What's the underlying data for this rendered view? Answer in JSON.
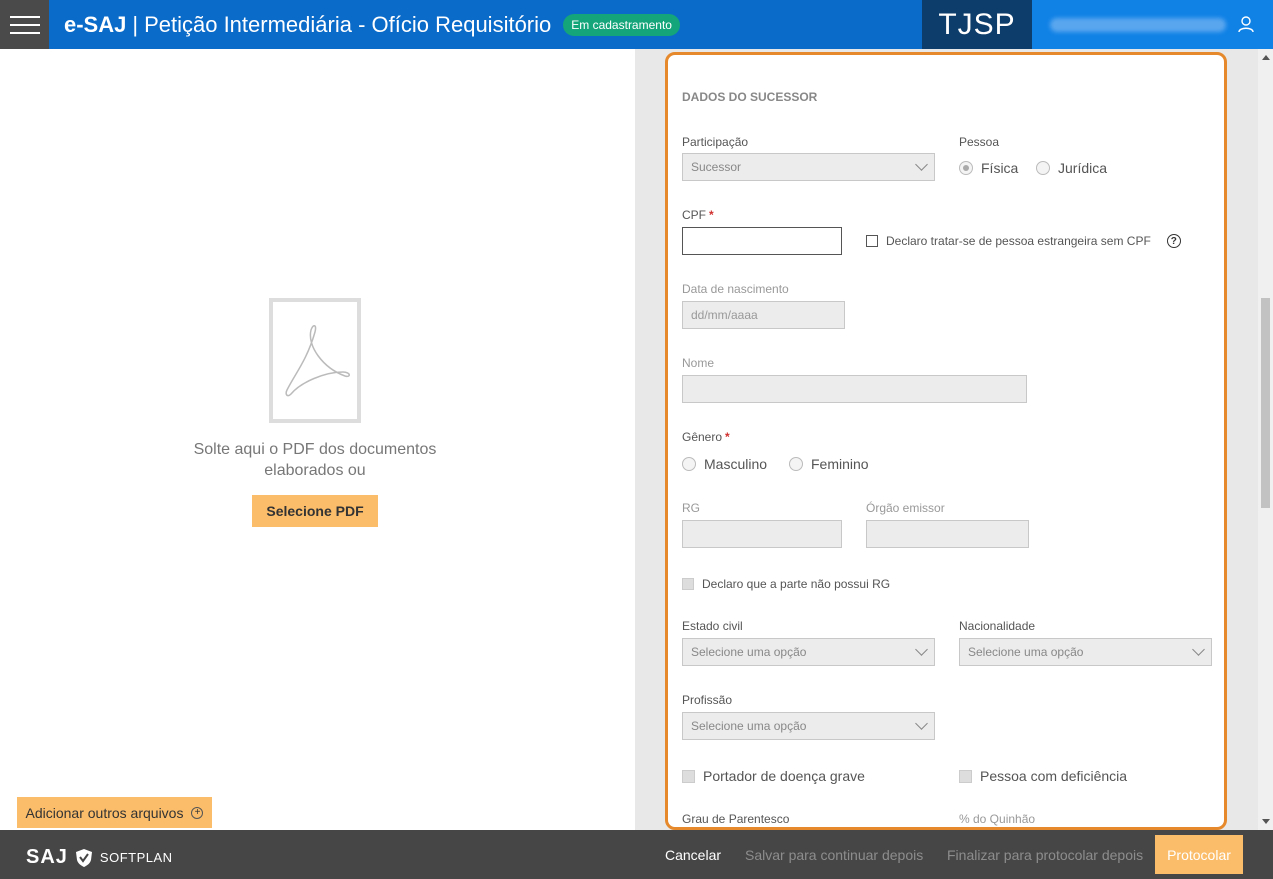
{
  "header": {
    "brand": "e-SAJ",
    "separator": "|",
    "title": "Petição Intermediária - Ofício Requisitório",
    "status_badge": "Em cadastramento",
    "court": "TJSP"
  },
  "left": {
    "drop_text": "Solte aqui o PDF dos documentos elaborados ou",
    "select_pdf": "Selecione PDF",
    "add_files": "Adicionar outros arquivos"
  },
  "form": {
    "section_title": "DADOS DO SUCESSOR",
    "participacao": {
      "label": "Participação",
      "value": "Sucessor"
    },
    "pessoa": {
      "label": "Pessoa",
      "options": [
        "Física",
        "Jurídica"
      ],
      "selected": "Física"
    },
    "cpf": {
      "label": "CPF",
      "value": ""
    },
    "foreign_check": "Declaro tratar-se de pessoa estrangeira sem CPF",
    "nascimento": {
      "label": "Data de nascimento",
      "placeholder": "dd/mm/aaaa"
    },
    "nome": {
      "label": "Nome",
      "value": ""
    },
    "genero": {
      "label": "Gênero",
      "options": [
        "Masculino",
        "Feminino"
      ]
    },
    "rg": {
      "label": "RG"
    },
    "orgao": {
      "label": "Órgão emissor"
    },
    "no_rg_check": "Declaro que a parte não possui RG",
    "estado_civil": {
      "label": "Estado civil",
      "value": "Selecione uma opção"
    },
    "nacionalidade": {
      "label": "Nacionalidade",
      "value": "Selecione uma opção"
    },
    "profissao": {
      "label": "Profissão",
      "value": "Selecione uma opção"
    },
    "doenca_check": "Portador de doença grave",
    "deficiencia_check": "Pessoa com deficiência",
    "grau": {
      "label": "Grau de Parentesco"
    },
    "quinhao": {
      "label": "% do Quinhão"
    }
  },
  "footer": {
    "logo_saj": "SAJ",
    "logo_softplan": "SOFTPLAN",
    "cancel": "Cancelar",
    "save": "Salvar para continuar depois",
    "finalize": "Finalizar para protocolar depois",
    "protocol": "Protocolar"
  },
  "colors": {
    "header_blue": "#0b6bc9",
    "court_navy": "#0d3d6b",
    "badge_green": "#14a57a",
    "accent_orange": "#fbbd6a",
    "card_border": "#e5892c"
  }
}
